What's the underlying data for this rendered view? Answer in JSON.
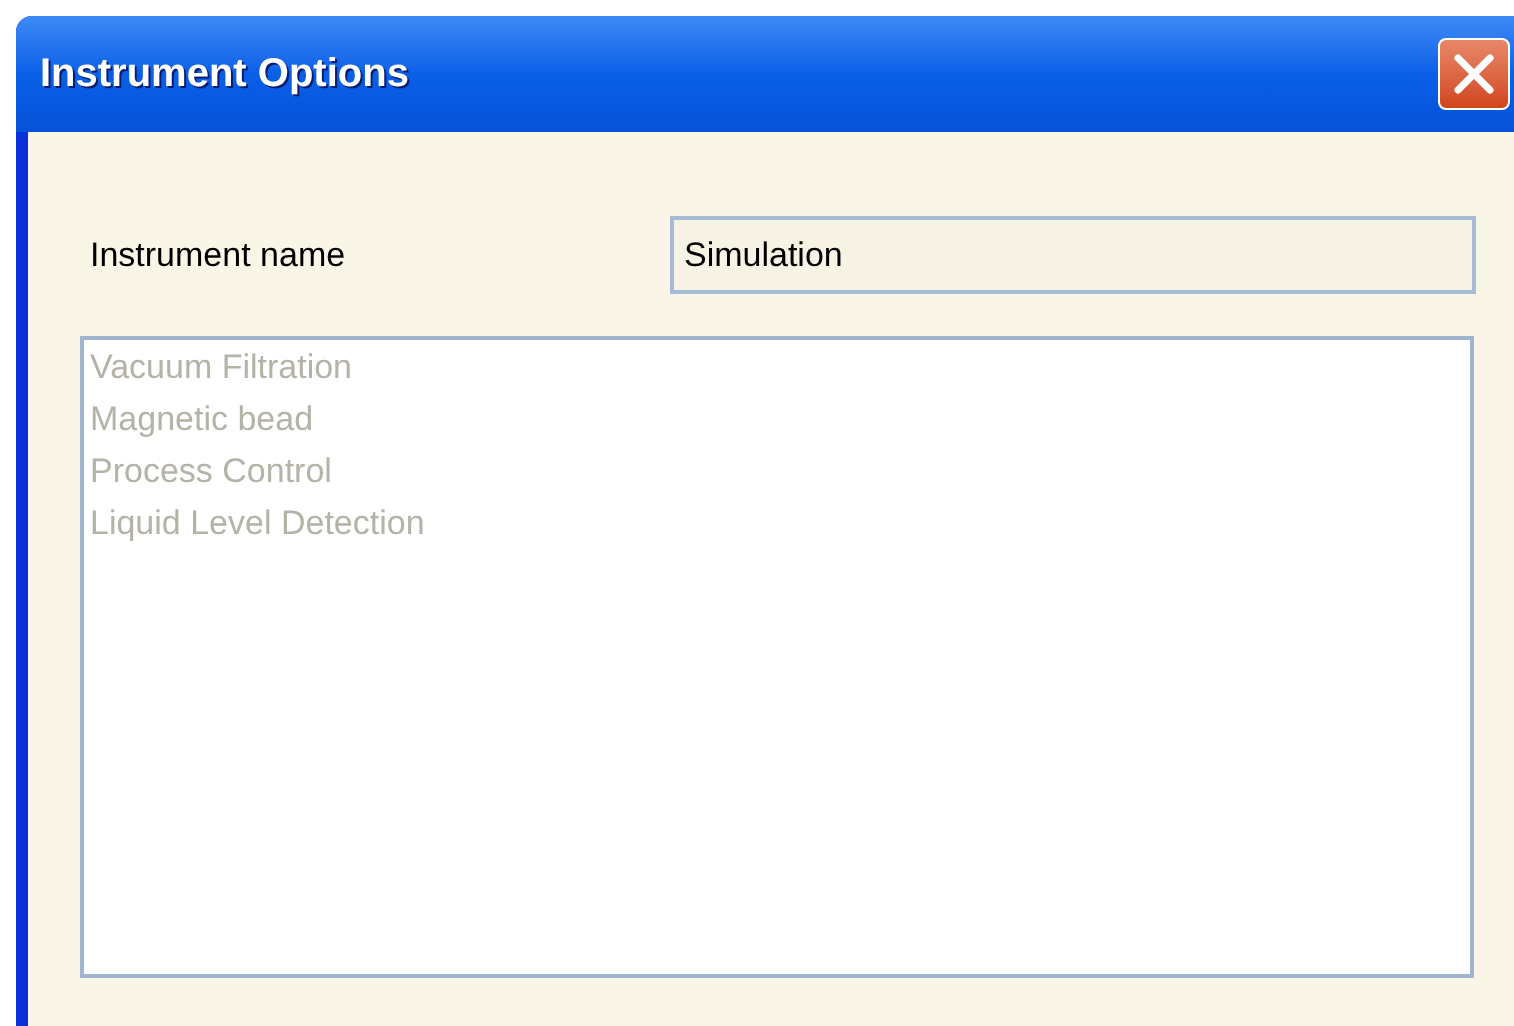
{
  "window": {
    "title": "Instrument Options"
  },
  "instrument_name": {
    "label": "Instrument name",
    "value": "Simulation"
  },
  "options_list": {
    "disabled": true,
    "items": [
      {
        "label": "Vacuum Filtration"
      },
      {
        "label": "Magnetic bead"
      },
      {
        "label": "Process Control"
      },
      {
        "label": "Liquid Level Detection"
      }
    ]
  }
}
